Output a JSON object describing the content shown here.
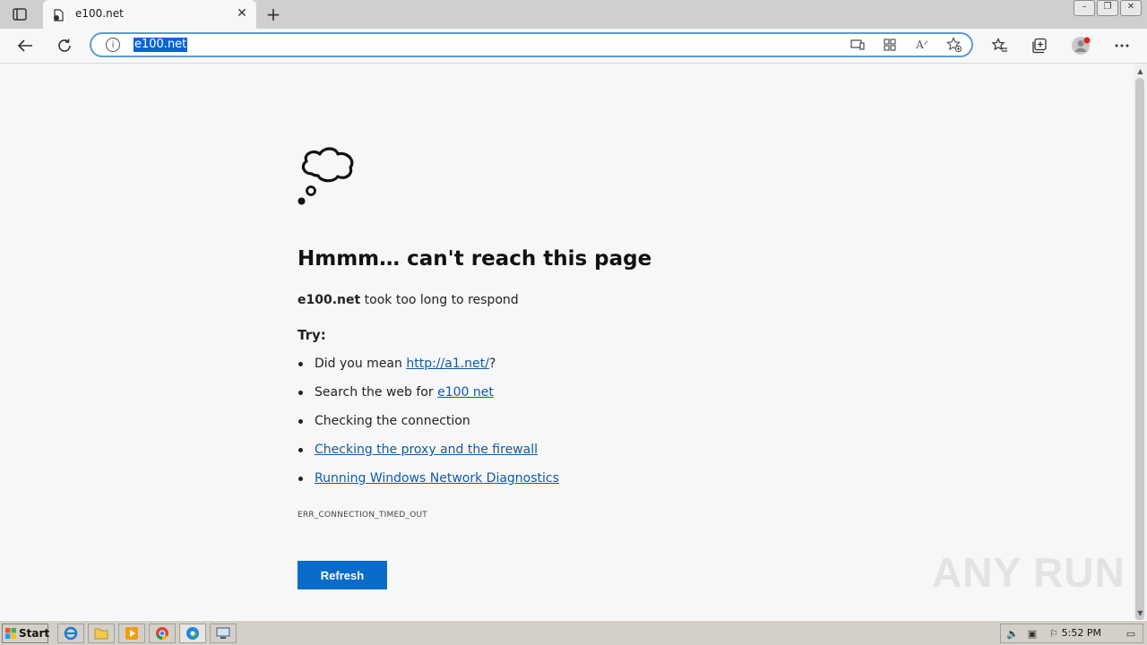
{
  "browser": {
    "tab": {
      "title": "e100.net"
    },
    "address": {
      "url": "e100.net"
    },
    "icons": {
      "tab_actions": "tab-actions-icon",
      "favicon": "page-icon",
      "tab_close": "close-icon",
      "new_tab": "plus-icon",
      "back": "back-arrow-icon",
      "refresh": "refresh-icon",
      "site_info": "info-icon",
      "app_available": "app-available-icon",
      "apps": "apps-icon",
      "read_aloud": "read-aloud-icon",
      "add_favorite": "add-favorite-icon",
      "favorites": "favorites-icon",
      "collections": "collections-icon",
      "profile": "profile-icon",
      "more": "more-icon"
    }
  },
  "error_page": {
    "heading": "Hmmm… can't reach this page",
    "host": "e100.net",
    "description_suffix": " took too long to respond",
    "try_label": "Try:",
    "suggestions": {
      "s1_prefix": "Did you mean ",
      "s1_link": "http://a1.net/",
      "s1_suffix": "?",
      "s2_prefix": "Search the web for ",
      "s2_link": "e100 net",
      "s3_text": "Checking the connection",
      "s4_link": "Checking the proxy and the firewall",
      "s5_link": "Running Windows Network Diagnostics"
    },
    "error_code": "ERR_CONNECTION_TIMED_OUT",
    "refresh_label": "Refresh",
    "cloud_icon": "thought-cloud-icon"
  },
  "watermark": {
    "text": "ANY RUN"
  },
  "taskbar": {
    "start_label": "Start",
    "clock": "5:52 PM",
    "apps": [
      "ie-icon",
      "explorer-folder-icon",
      "media-player-icon",
      "chrome-icon",
      "edge-icon",
      "system-monitor-icon"
    ]
  },
  "colors": {
    "accent": "#0a6cc9",
    "link": "#0a5cad",
    "page_bg": "#f7f7f7",
    "taskbar_bg": "#d4d0c8"
  }
}
